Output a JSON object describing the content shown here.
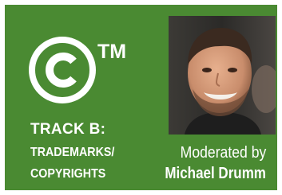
{
  "session": {
    "trademark_symbol": "TM",
    "track_label": "TRACK B:",
    "track_title_line1": "TRADEMARKS/",
    "track_title_line2": "COPYRIGHTS",
    "moderated_by": "Moderated by",
    "moderator_name": "Michael Drumm"
  },
  "icons": {
    "copyright": "copyright-icon"
  },
  "colors": {
    "background": "#4a8a32",
    "text": "#ffffff"
  }
}
